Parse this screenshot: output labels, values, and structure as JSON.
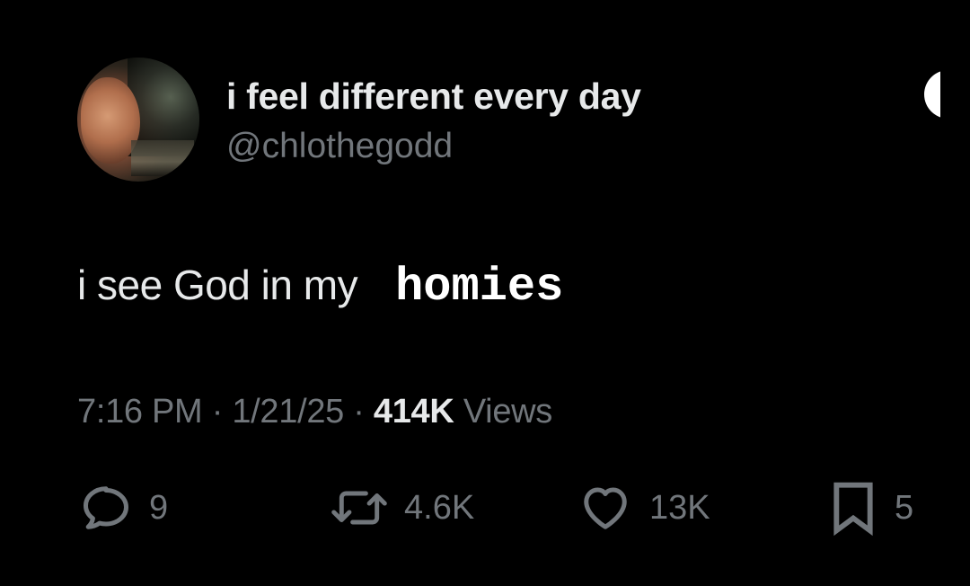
{
  "author": {
    "display_name": "i feel different every day",
    "handle": "@chlothegodd"
  },
  "tweet": {
    "text_main": "i see God in my",
    "text_styled": "homies"
  },
  "meta": {
    "time": "7:16 PM",
    "date": "1/21/25",
    "views_count": "414K",
    "views_label": "Views"
  },
  "actions": {
    "replies": "9",
    "reposts": "4.6K",
    "likes": "13K",
    "bookmarks": "5"
  },
  "colors": {
    "background": "#000000",
    "primary_text": "#e7e9ea",
    "secondary_text": "#71767b"
  }
}
